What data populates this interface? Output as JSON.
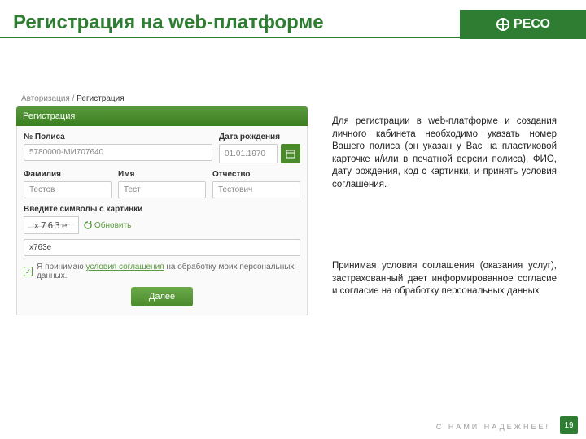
{
  "brand": "РЕСО",
  "page_title": "Регистрация на web-платформе",
  "crumbs": {
    "auth": "Авторизация",
    "sep": " / ",
    "reg": "Регистрация"
  },
  "panel": {
    "title": "Регистрация",
    "policy_label": "№ Полиса",
    "policy_value": "5780000-МИ707640",
    "dob_label": "Дата рождения",
    "dob_value": "01.01.1970",
    "last_label": "Фамилия",
    "last_value": "Тестов",
    "first_label": "Имя",
    "first_value": "Тест",
    "mid_label": "Отчество",
    "mid_value": "Тестович",
    "captcha_label": "Введите символы с картинки",
    "captcha_img": "x763e",
    "captcha_refresh": "Обновить",
    "captcha_value": "x763e",
    "agree_pre": "Я принимаю ",
    "agree_link": "условия соглашения",
    "agree_post": " на обработку моих персональных данных.",
    "submit": "Далее"
  },
  "text": {
    "p1": "Для регистрации в web-платформе и создания личного кабинета необходимо указать номер Вашего полиса (он указан у Вас на пластиковой карточке и/или в печатной версии полиса), ФИО, дату рождения, код с картинки, и принять условия соглашения.",
    "p2": "Принимая условия соглашения (оказания услуг), застрахованный дает информированное согласие и согласие на обработку персональных данных"
  },
  "footer": {
    "slogan": "С  НАМИ  НАДЕЖНЕЕ!",
    "page": "19"
  }
}
